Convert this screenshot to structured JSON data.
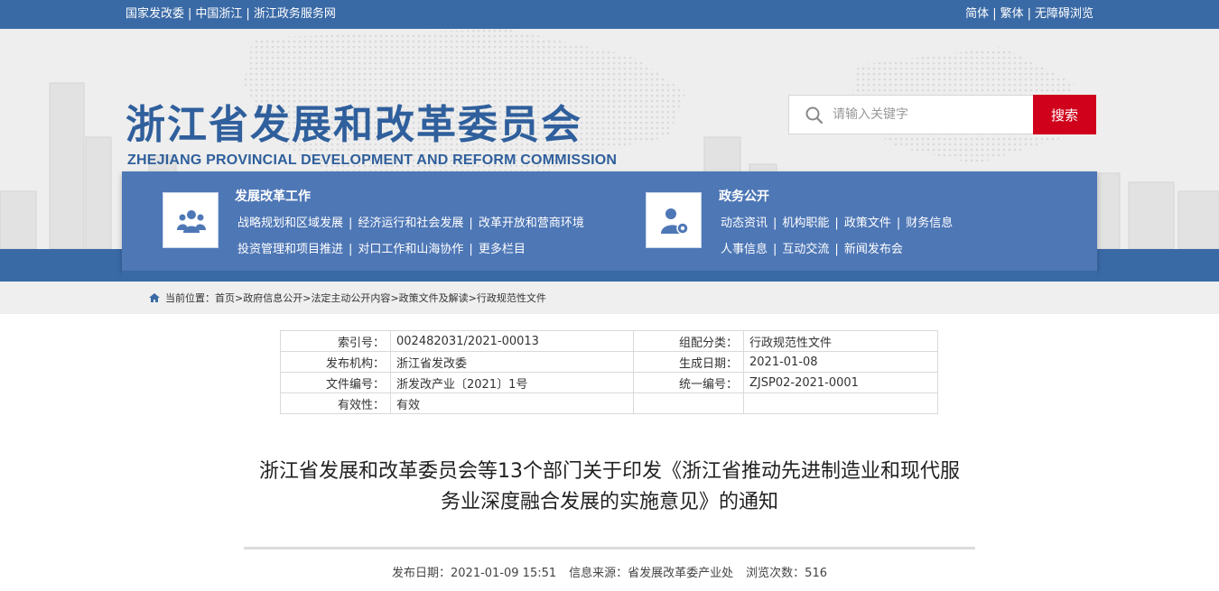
{
  "topbar": {
    "links_left": [
      "国家发改委",
      "中国浙江",
      "浙江政务服务网"
    ],
    "links_right": [
      "简体",
      "繁体",
      "无障碍浏览"
    ]
  },
  "header": {
    "title_cn": "浙江省发展和改革委员会",
    "title_en": "ZHEJIANG PROVINCIAL DEVELOPMENT AND REFORM COMMISSION",
    "search": {
      "placeholder": "请输入关键字",
      "button": "搜索"
    }
  },
  "nav": {
    "block1": {
      "title": "发展改革工作",
      "row1": [
        "战略规划和区域发展",
        "经济运行和社会发展",
        "改革开放和营商环境"
      ],
      "row2": [
        "投资管理和项目推进",
        "对口工作和山海协作",
        "更多栏目"
      ]
    },
    "block2": {
      "title": "政务公开",
      "row1": [
        "动态资讯",
        "机构职能",
        "政策文件",
        "财务信息"
      ],
      "row2": [
        "人事信息",
        "互动交流",
        "新闻发布会"
      ]
    }
  },
  "breadcrumb": {
    "prefix": "当前位置：",
    "items": [
      "首页",
      "政府信息公开",
      "法定主动公开内容",
      "政策文件及解读",
      "行政规范性文件"
    ]
  },
  "meta": {
    "rows": [
      {
        "l1": "索引号：",
        "v1": "002482031/2021-00013",
        "l2": "组配分类：",
        "v2": "行政规范性文件"
      },
      {
        "l1": "发布机构：",
        "v1": "浙江省发改委",
        "l2": "生成日期：",
        "v2": "2021-01-08"
      },
      {
        "l1": "文件编号：",
        "v1": "浙发改产业〔2021〕1号",
        "l2": "统一编号：",
        "v2": "ZJSP02-2021-0001"
      },
      {
        "l1": "有效性：",
        "v1": "有效",
        "l2": "",
        "v2": ""
      }
    ]
  },
  "document": {
    "title_line1": "浙江省发展和改革委员会等13个部门关于印发《浙江省推动先进制造业和现代服",
    "title_line2": "务业深度融合发展的实施意见》的通知",
    "publish_date": "发布日期：2021-01-09 15:51",
    "source": "信息来源：省发展改革委产业处",
    "views": "浏览次数：516"
  },
  "colors": {
    "primary": "#3a6aa6",
    "panel": "#4e77b6",
    "search_button": "#d0021b",
    "title": "#2f5f9c"
  }
}
